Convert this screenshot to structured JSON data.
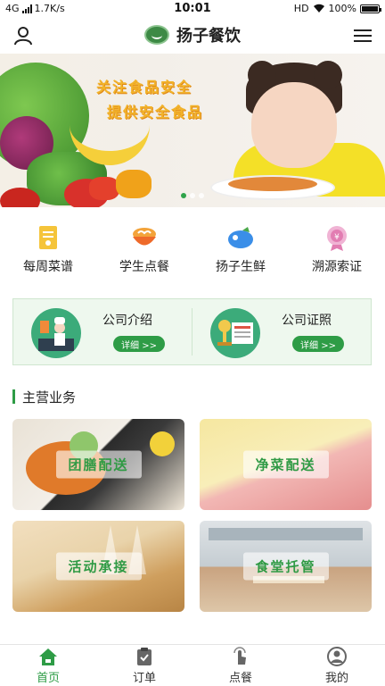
{
  "status_bar": {
    "network": "4G",
    "speed": "1.7K/s",
    "time": "10:01",
    "hd": "HD",
    "battery": "100%"
  },
  "header": {
    "title": "扬子餐饮",
    "user_icon": "user-icon",
    "menu_icon": "menu-icon"
  },
  "banner": {
    "line1": "关注食品安全",
    "line2": "提供安全食品",
    "active_slide": 1,
    "slide_count": 3
  },
  "quick_nav": [
    {
      "label": "每周菜谱",
      "icon": "menu-book-icon"
    },
    {
      "label": "学生点餐",
      "icon": "meal-bowl-icon"
    },
    {
      "label": "扬子生鲜",
      "icon": "fresh-produce-icon"
    },
    {
      "label": "溯源索证",
      "icon": "trace-certificate-icon"
    }
  ],
  "intro": [
    {
      "title": "公司介绍",
      "button": "详细 >>"
    },
    {
      "title": "公司证照",
      "button": "详细 >>"
    }
  ],
  "section": {
    "title": "主营业务"
  },
  "business": [
    {
      "label": "团膳配送"
    },
    {
      "label": "净菜配送"
    },
    {
      "label": "活动承接"
    },
    {
      "label": "食堂托管"
    }
  ],
  "tabbar": [
    {
      "label": "首页",
      "icon": "home-icon",
      "active": true
    },
    {
      "label": "订单",
      "icon": "order-clipboard-icon",
      "active": false
    },
    {
      "label": "点餐",
      "icon": "tap-order-icon",
      "active": false
    },
    {
      "label": "我的",
      "icon": "profile-icon",
      "active": false
    }
  ],
  "colors": {
    "accent": "#2e9c46",
    "intro_bg": "#eef8ee",
    "banner_text": "#f2b32a"
  }
}
